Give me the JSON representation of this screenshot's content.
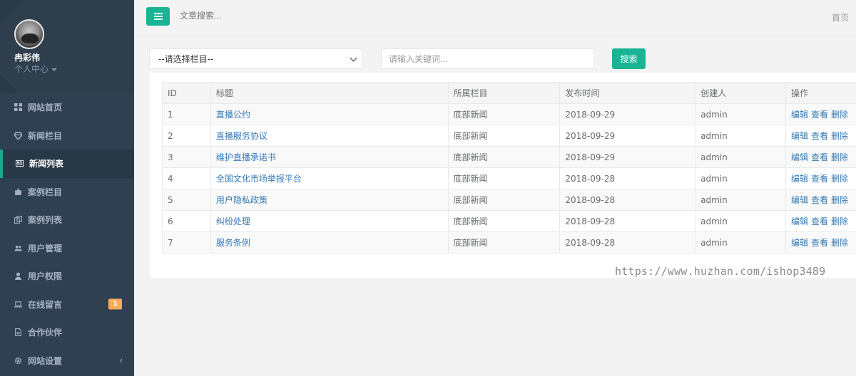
{
  "profile": {
    "name": "冉彩伟",
    "link": "个人中心"
  },
  "menu": [
    {
      "label": "网站首页",
      "icon": "grid-icon",
      "active": false
    },
    {
      "label": "新闻栏目",
      "icon": "diamond-icon",
      "active": false
    },
    {
      "label": "新闻列表",
      "icon": "newspaper-icon",
      "active": true
    },
    {
      "label": "案例栏目",
      "icon": "puzzle-icon",
      "active": false
    },
    {
      "label": "案例列表",
      "icon": "copy-icon",
      "active": false
    },
    {
      "label": "用户管理",
      "icon": "users-icon",
      "active": false
    },
    {
      "label": "用户权限",
      "icon": "user-icon",
      "active": false
    },
    {
      "label": "在线留言",
      "icon": "laptop-icon",
      "active": false,
      "badge": "1"
    },
    {
      "label": "合作伙伴",
      "icon": "file-icon",
      "active": false
    },
    {
      "label": "网站设置",
      "icon": "gear-icon",
      "active": false,
      "arrow": "‹"
    }
  ],
  "topbar": {
    "search_placeholder": "文章搜索...",
    "home_link": "首页"
  },
  "filters": {
    "category_selected": "--请选择栏目--",
    "keyword_placeholder": "请输入关键词...",
    "search_label": "搜索"
  },
  "table": {
    "headers": [
      "ID",
      "标题",
      "所属栏目",
      "发布时间",
      "创建人",
      "操作"
    ],
    "actions": [
      "编辑",
      "查看",
      "删除"
    ],
    "rows": [
      {
        "id": "1",
        "title": "直播公约",
        "category": "底部新闻",
        "date": "2018-09-29",
        "creator": "admin"
      },
      {
        "id": "2",
        "title": "直播服务协议",
        "category": "底部新闻",
        "date": "2018-09-29",
        "creator": "admin"
      },
      {
        "id": "3",
        "title": "维护直播承诺书",
        "category": "底部新闻",
        "date": "2018-09-29",
        "creator": "admin"
      },
      {
        "id": "4",
        "title": "全国文化市场举报平台",
        "category": "底部新闻",
        "date": "2018-09-28",
        "creator": "admin"
      },
      {
        "id": "5",
        "title": "用户隐私政策",
        "category": "底部新闻",
        "date": "2018-09-28",
        "creator": "admin"
      },
      {
        "id": "6",
        "title": "纠纷处理",
        "category": "底部新闻",
        "date": "2018-09-28",
        "creator": "admin"
      },
      {
        "id": "7",
        "title": "服务条例",
        "category": "底部新闻",
        "date": "2018-09-28",
        "creator": "admin"
      }
    ]
  },
  "watermark": "https://www.huzhan.com/ishop3489"
}
